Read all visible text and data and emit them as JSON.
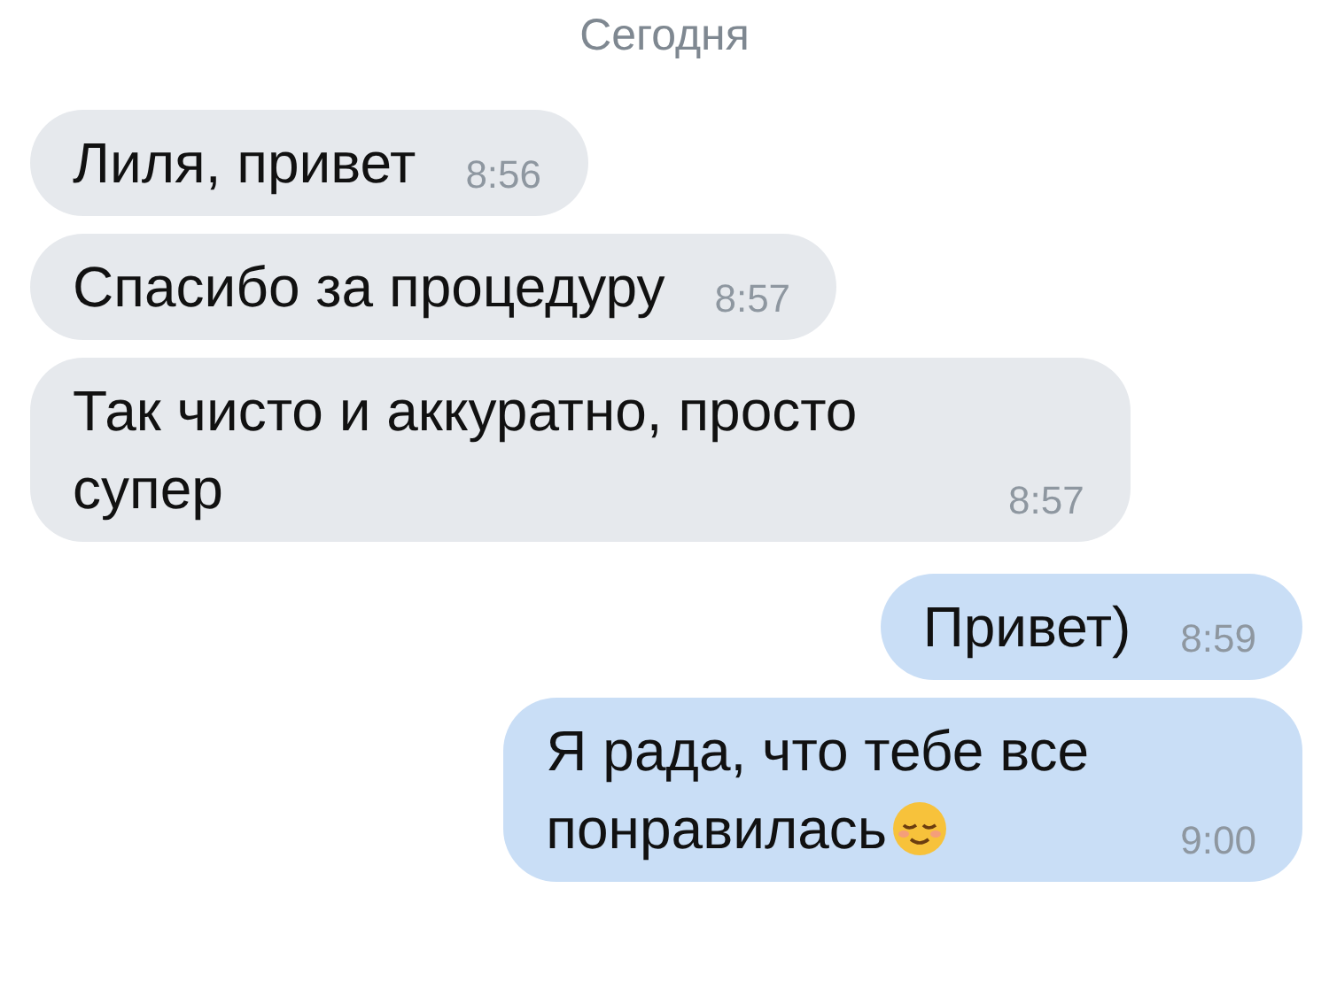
{
  "date_label": "Сегодня",
  "messages": [
    {
      "kind": "incoming",
      "text": "Лиля, привет",
      "time": "8:56"
    },
    {
      "kind": "incoming",
      "text": "Спасибо за процедуру",
      "time": "8:57"
    },
    {
      "kind": "incoming",
      "text": "Так чисто и аккуратно, просто супер",
      "time": "8:57"
    },
    {
      "kind": "outgoing",
      "text": "Привет)",
      "time": "8:59"
    },
    {
      "kind": "outgoing",
      "text": "Я рада, что тебе все понравилась",
      "time": "9:00",
      "emoji": true
    }
  ]
}
